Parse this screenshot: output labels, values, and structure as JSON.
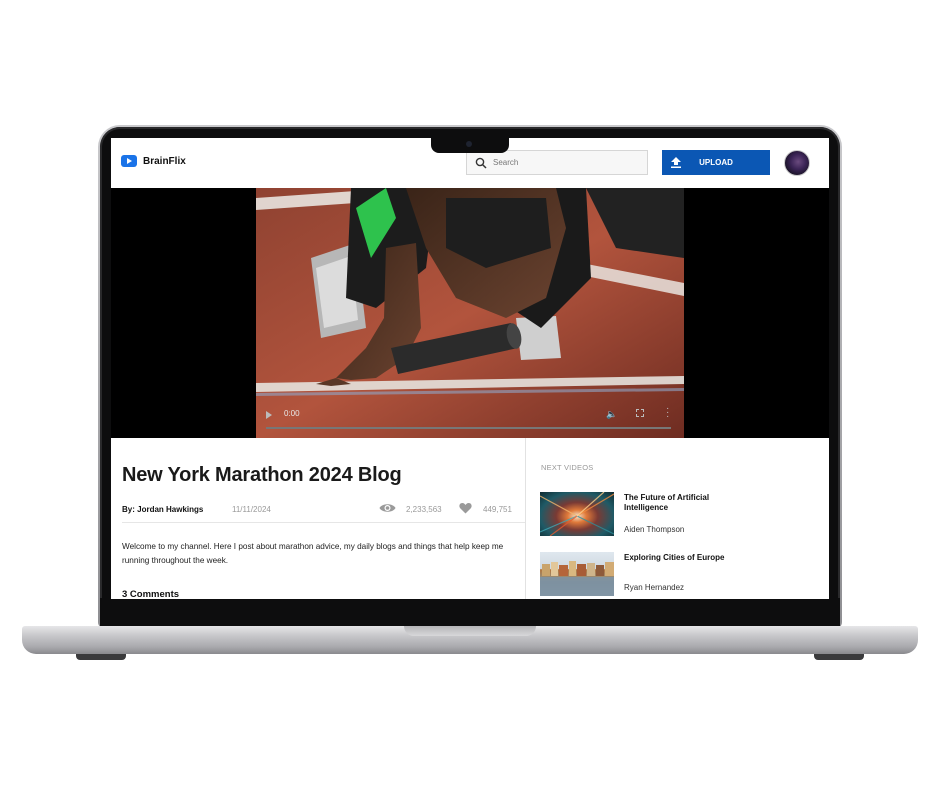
{
  "app": {
    "name": "BrainFlix"
  },
  "header": {
    "search_placeholder": "Search",
    "upload_label": "UPLOAD"
  },
  "player": {
    "time": "0:00",
    "progress": 0
  },
  "video": {
    "title": "New York Marathon 2024 Blog",
    "author": "By: Jordan Hawkings",
    "date": "11/11/2024",
    "views": "2,233,563",
    "likes": "449,751",
    "description": "Welcome to my channel. Here I post about marathon advice, my daily blogs and things that help keep me running throughout the week.",
    "comments_heading": "3 Comments"
  },
  "sidebar": {
    "heading": "NEXT VIDEOS",
    "items": [
      {
        "title": "The Future of Artificial Intelligence",
        "author": "Aiden Thompson"
      },
      {
        "title": "Exploring Cities of Europe",
        "author": "Ryan Hernandez"
      }
    ]
  },
  "icons": {
    "logo": "play-icon",
    "search": "search-icon",
    "upload": "upload-icon",
    "views": "eye-icon",
    "likes": "heart-icon"
  },
  "colors": {
    "accent": "#0b57b4",
    "logo": "#1a73e8"
  }
}
